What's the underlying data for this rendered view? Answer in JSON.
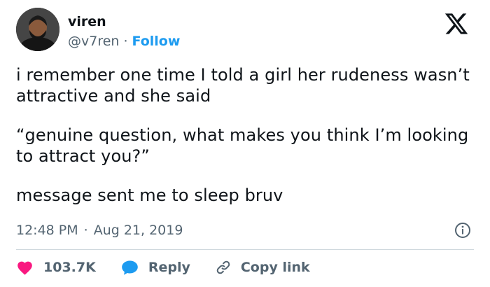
{
  "user": {
    "display_name": "viren",
    "handle": "@v7ren",
    "separator": "·",
    "follow_label": "Follow"
  },
  "tweet": {
    "paragraphs": [
      "i remember one time I told a girl her rudeness wasn’t attractive and she said",
      "“genuine question, what makes you think I’m looking to attract you?”",
      "message sent me to sleep bruv"
    ],
    "time": "12:48 PM",
    "date_separator": "·",
    "date": "Aug 21, 2019"
  },
  "actions": {
    "likes": "103.7K",
    "reply_label": "Reply",
    "copy_link_label": "Copy link"
  },
  "icons": {
    "logo": "x-logo-icon",
    "info": "info-icon",
    "like": "heart-icon",
    "reply": "speech-bubble-icon",
    "copy": "link-icon"
  },
  "colors": {
    "accent": "#1d9bf0",
    "heart": "#f91880",
    "text": "#0f1419",
    "secondary": "#536471",
    "divider": "#cfd9de"
  }
}
